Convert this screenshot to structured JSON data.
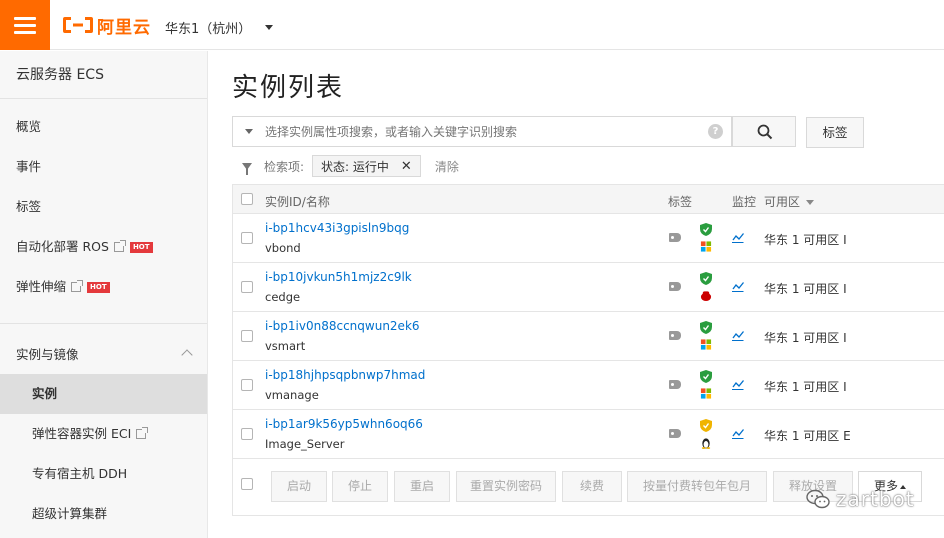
{
  "header": {
    "logo_text": "阿里云",
    "region": "华东1（杭州）"
  },
  "sidebar": {
    "title": "云服务器 ECS",
    "items": [
      {
        "label": "概览"
      },
      {
        "label": "事件"
      },
      {
        "label": "标签"
      },
      {
        "label": "自动化部署 ROS",
        "hot": "HOT"
      },
      {
        "label": "弹性伸缩",
        "hot": "HOT"
      }
    ],
    "group": {
      "label": "实例与镜像",
      "subitems": [
        {
          "label": "实例",
          "active": true
        },
        {
          "label": "弹性容器实例 ECI"
        },
        {
          "label": "专有宿主机 DDH"
        },
        {
          "label": "超级计算集群"
        }
      ]
    }
  },
  "main": {
    "title": "实例列表",
    "search": {
      "placeholder": "选择实例属性项搜索，或者输入关键字识别搜索",
      "help": "?"
    },
    "tag_button": "标签",
    "filter": {
      "label": "检索项:",
      "chip": "状态: 运行中",
      "chip_close": "✕",
      "clear": "清除"
    },
    "table": {
      "headers": {
        "id_name": "实例ID/名称",
        "tags": "标签",
        "monitor": "监控",
        "zone": "可用区"
      },
      "rows": [
        {
          "id": "i-bp1hcv43i3gpisln9bqg",
          "name": "vbond",
          "zone": "华东 1 可用区 I",
          "os": "windows",
          "shield": "green"
        },
        {
          "id": "i-bp10jvkun5h1mjz2c9lk",
          "name": "cedge",
          "zone": "华东 1 可用区 I",
          "os": "redhat",
          "shield": "green"
        },
        {
          "id": "i-bp1iv0n88ccnqwun2ek6",
          "name": "vsmart",
          "zone": "华东 1 可用区 I",
          "os": "windows",
          "shield": "green"
        },
        {
          "id": "i-bp18hjhpsqpbnwp7hmad",
          "name": "vmanage",
          "zone": "华东 1 可用区 I",
          "os": "windows",
          "shield": "green"
        },
        {
          "id": "i-bp1ar9k56yp5whn6oq66",
          "name": "Image_Server",
          "zone": "华东 1 可用区 E",
          "os": "linux",
          "shield": "yellow"
        }
      ]
    },
    "actions": {
      "start": "启动",
      "stop": "停止",
      "restart": "重启",
      "reset_password": "重置实例密码",
      "renew": "续费",
      "convert_billing": "按量付费转包年包月",
      "release": "释放设置",
      "more": "更多"
    }
  },
  "watermark": "zartbot",
  "colors": {
    "brand": "#ff6a00",
    "link": "#0070cc",
    "hot": "#e4393c"
  }
}
